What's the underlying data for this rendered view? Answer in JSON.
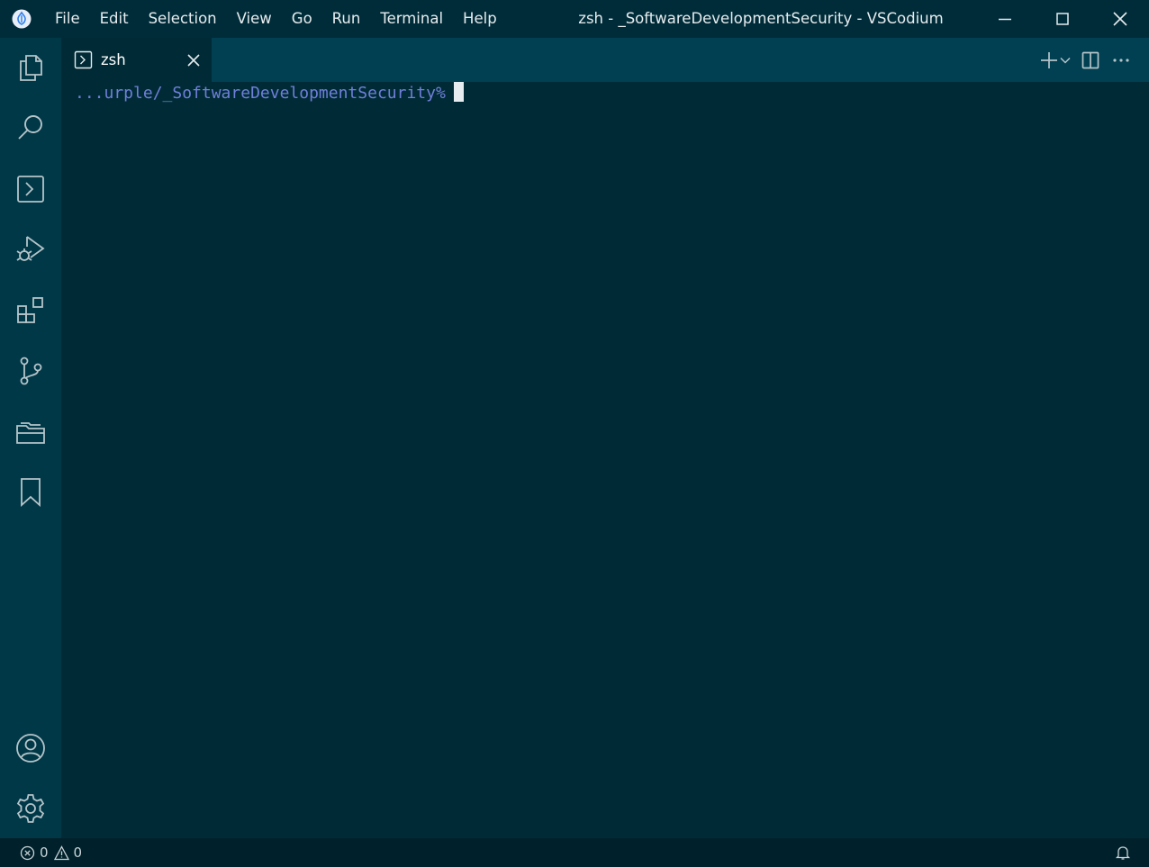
{
  "app": {
    "name": "VSCodium",
    "window_title": "zsh - _SoftwareDevelopmentSecurity - VSCodium"
  },
  "menu": {
    "items": [
      "File",
      "Edit",
      "Selection",
      "View",
      "Go",
      "Run",
      "Terminal",
      "Help"
    ]
  },
  "activity_bar": {
    "icons": [
      "explorer-icon",
      "search-icon",
      "terminal-icon",
      "run-debug-icon",
      "extensions-icon",
      "source-control-icon",
      "folder-icon",
      "bookmark-icon",
      "account-icon",
      "gear-icon"
    ]
  },
  "tabs": [
    {
      "label": "zsh",
      "icon": "terminal-icon"
    }
  ],
  "terminal": {
    "prompt": "...urple/_SoftwareDevelopmentSecurity%"
  },
  "status": {
    "errors": "0",
    "warnings": "0"
  },
  "colors": {
    "background": "#002b36",
    "activity_bar": "#003847",
    "tab_bar": "#004052",
    "status_bar": "#00212b",
    "prompt": "#6f7fd9",
    "icon": "#b5c4c9"
  }
}
